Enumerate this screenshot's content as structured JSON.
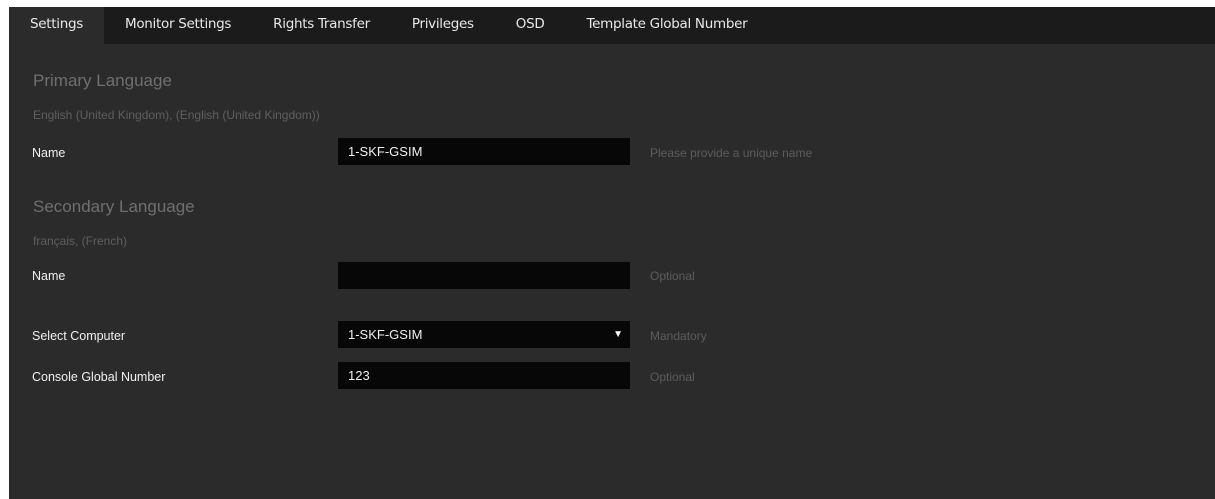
{
  "tabs": [
    {
      "label": "Settings",
      "active": true
    },
    {
      "label": "Monitor Settings",
      "active": false
    },
    {
      "label": "Rights Transfer",
      "active": false
    },
    {
      "label": "Privileges",
      "active": false
    },
    {
      "label": "OSD",
      "active": false
    },
    {
      "label": "Template Global Number",
      "active": false
    }
  ],
  "primary": {
    "title": "Primary Language",
    "language": "English (United Kingdom), (English (United Kingdom))",
    "name_label": "Name",
    "name_value": "1-SKF-GSIM",
    "name_hint": "Please provide a unique name"
  },
  "secondary": {
    "title": "Secondary Language",
    "language": "français, (French)",
    "name_label": "Name",
    "name_value": "",
    "name_hint": "Optional"
  },
  "computer": {
    "label": "Select Computer",
    "selected": "1-SKF-GSIM",
    "hint": "Mandatory"
  },
  "console": {
    "label": "Console Global Number",
    "value": "123",
    "hint": "Optional"
  },
  "colors": {
    "tabbar_bg": "#1b1b1b",
    "panel_bg": "#2b2b2b",
    "field_bg": "#070707"
  }
}
